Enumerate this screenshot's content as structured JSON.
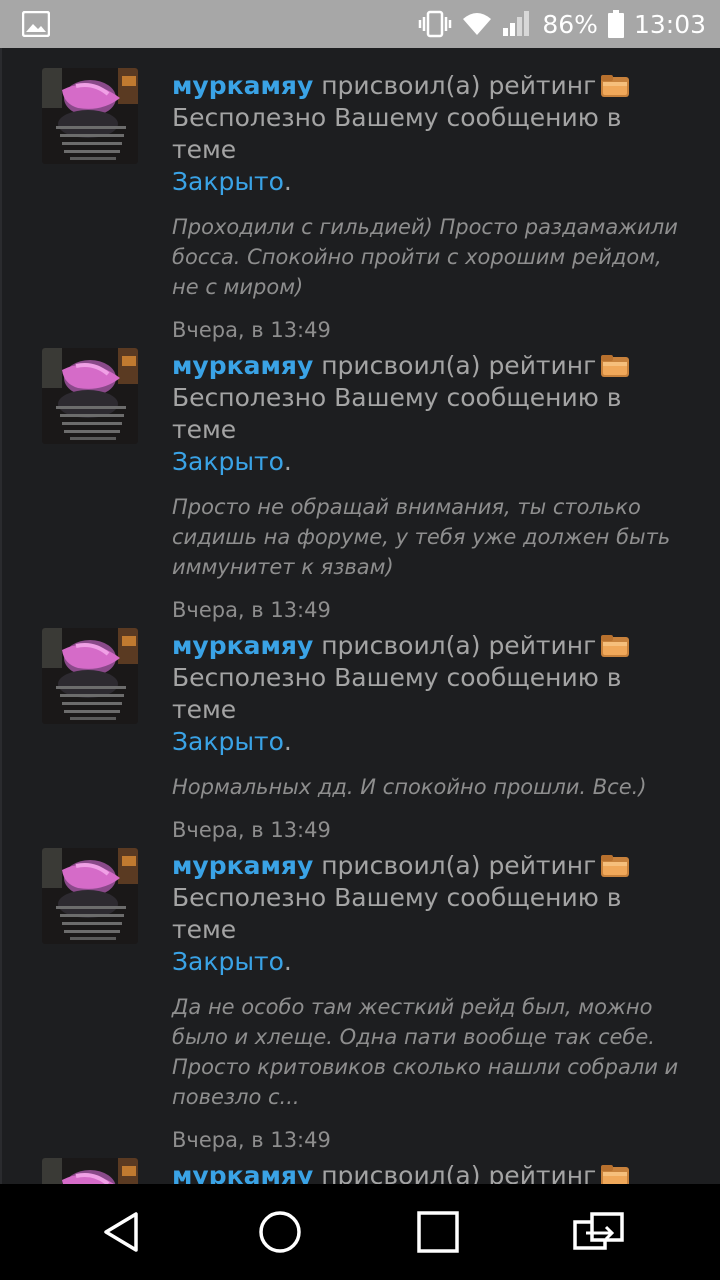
{
  "status_bar": {
    "battery_percent": "86%",
    "time": "13:03",
    "icons": [
      "image-icon",
      "vibrate-icon",
      "wifi-icon",
      "signal-icon",
      "battery-icon"
    ]
  },
  "notifications": [
    {
      "user": "муркамяу",
      "action": "присвоил(а) рейтинг",
      "rating_icon": "folder-rating-icon",
      "message_line": "Бесполезно Вашему сообщению в теме",
      "topic": "Закрыто",
      "period": ".",
      "quote": "Проходили с гильдией) Просто раздамажили босса. Спокойно пройти с хорошим рейдом, не с миром)",
      "time": "Вчера, в 13:49"
    },
    {
      "user": "муркамяу",
      "action": "присвоил(а) рейтинг",
      "rating_icon": "folder-rating-icon",
      "message_line": "Бесполезно Вашему сообщению в теме",
      "topic": "Закрыто",
      "period": ".",
      "quote": "Просто не обращай внимания, ты столько сидишь на форуме, у тебя уже должен быть иммунитет к язвам)",
      "time": "Вчера, в 13:49"
    },
    {
      "user": "муркамяу",
      "action": "присвоил(а) рейтинг",
      "rating_icon": "folder-rating-icon",
      "message_line": "Бесполезно Вашему сообщению в теме",
      "topic": "Закрыто",
      "period": ".",
      "quote": "Нормальных дд. И спокойно прошли. Все.)",
      "time": "Вчера, в 13:49"
    },
    {
      "user": "муркамяу",
      "action": "присвоил(а) рейтинг",
      "rating_icon": "folder-rating-icon",
      "message_line": "Бесполезно Вашему сообщению в теме",
      "topic": "Закрыто",
      "period": ".",
      "quote": "Да не особо там жесткий рейд был, можно было и хлеще. Одна пати вообще так себе. Просто критовиков сколько нашли собрали и повезло с...",
      "time": "Вчера, в 13:49"
    },
    {
      "user": "муркамяу",
      "action": "присвоил(а) рейтинг",
      "rating_icon": "folder-rating-icon"
    }
  ],
  "nav_bar": {
    "buttons": [
      "back-icon",
      "home-icon",
      "recents-icon",
      "switch-app-icon"
    ]
  }
}
